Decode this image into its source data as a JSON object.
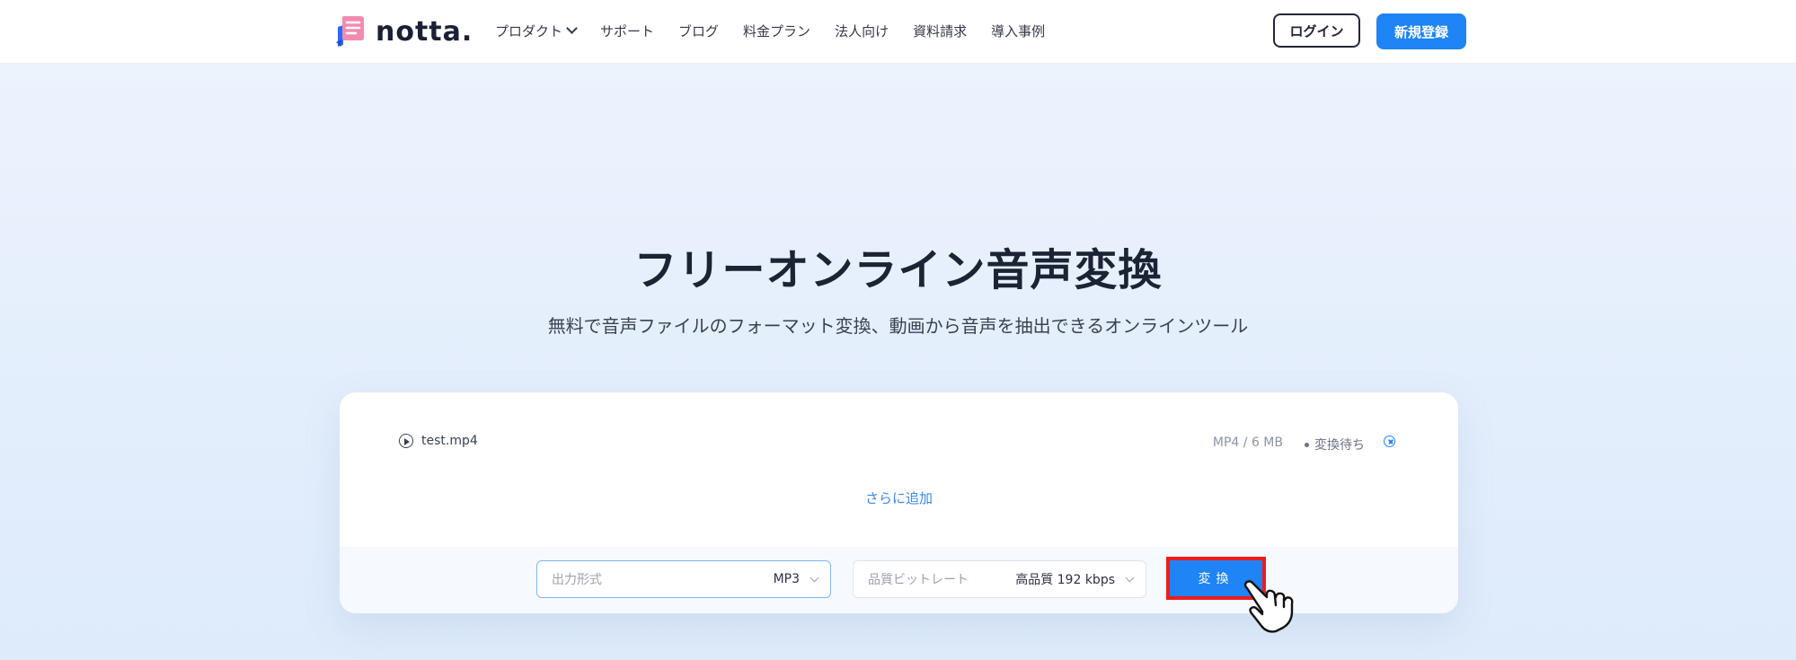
{
  "header": {
    "logo_text": "notta.",
    "nav": [
      {
        "label": "プロダクト",
        "has_dropdown": true
      },
      {
        "label": "サポート"
      },
      {
        "label": "ブログ"
      },
      {
        "label": "料金プラン"
      },
      {
        "label": "法人向け"
      },
      {
        "label": "資料請求"
      },
      {
        "label": "導入事例"
      }
    ],
    "login_label": "ログイン",
    "signup_label": "新規登録"
  },
  "hero": {
    "title": "フリーオンライン音声変換",
    "subtitle": "無料で音声ファイルのフォーマット変換、動画から音声を抽出できるオンラインツール"
  },
  "converter": {
    "file": {
      "name": "test.mp4",
      "meta": "MP4 / 6 MB",
      "status": "変換待ち",
      "play_icon": "play-circle-icon",
      "remove_icon": "close-circle-icon"
    },
    "add_more_label": "さらに追加",
    "format_select": {
      "label": "出力形式",
      "value": "MP3"
    },
    "bitrate_select": {
      "label": "品質ビットレート",
      "value": "高品質 192 kbps"
    },
    "convert_label": "変換",
    "highlight_color": "#ef1c1c"
  },
  "colors": {
    "accent": "#1f84f5",
    "hero_bg": "#e3eefc",
    "title": "#1c2334"
  }
}
